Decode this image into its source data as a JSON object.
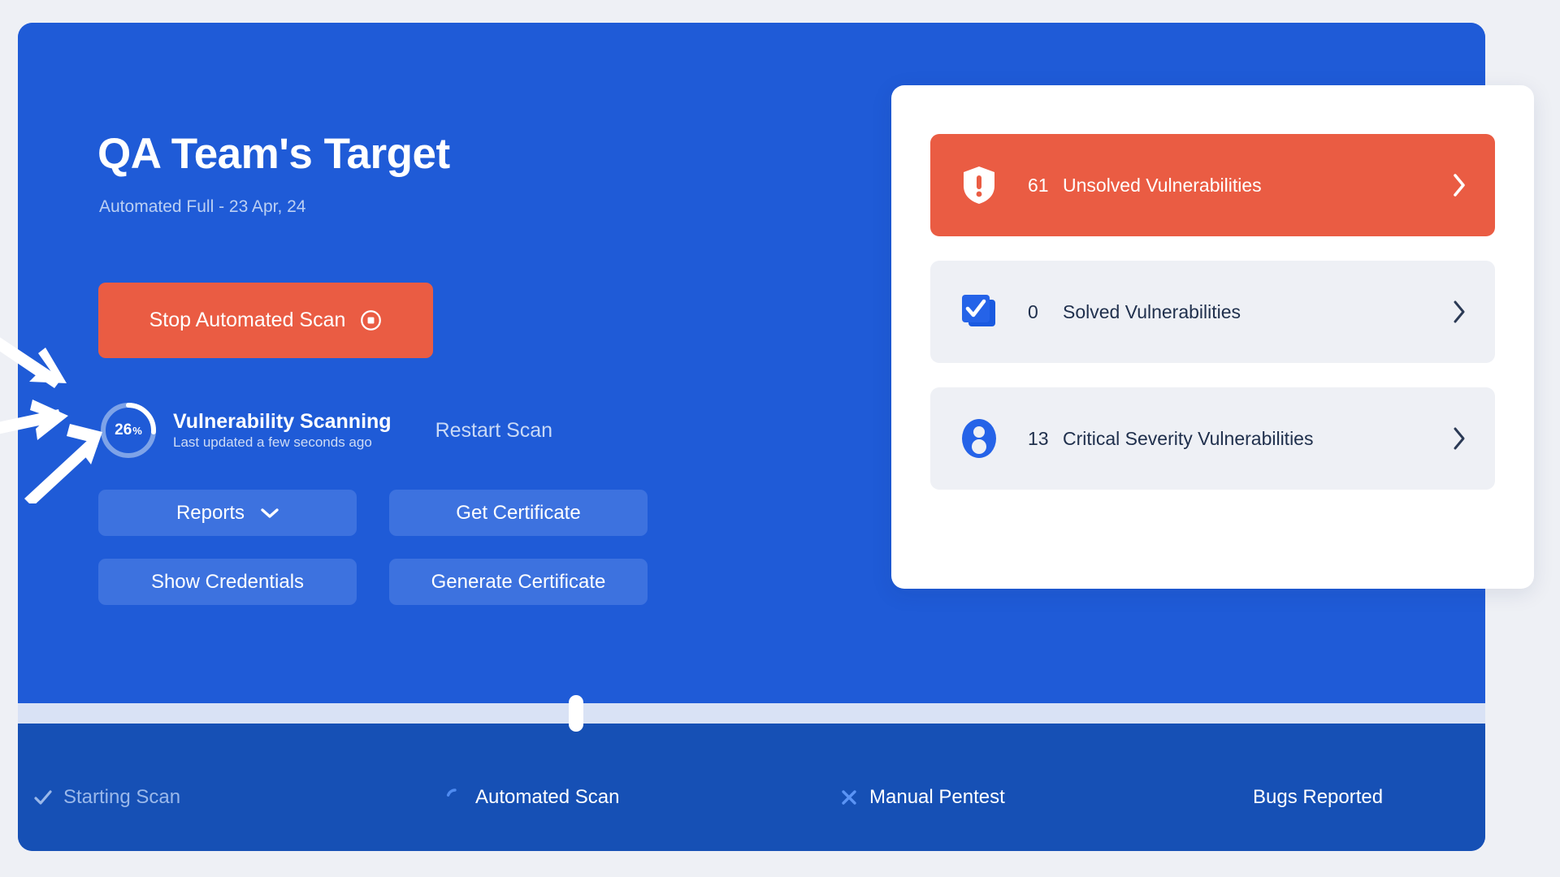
{
  "theme": {
    "page_bg": "#eef0f5",
    "panel_blue": "#1f5bd7",
    "footer_blue": "#1650b5",
    "accent_red": "#ea5c43",
    "button_blue": "#3d72df",
    "card_bg": "#eef0f5",
    "track": "#d9e2f5"
  },
  "header": {
    "title": "QA Team's Target",
    "subtitle": "Automated Full - 23 Apr, 24"
  },
  "scan": {
    "stop_button_label": "Stop Automated Scan",
    "stop_icon": "stop-circle-icon",
    "progress_percent": "26",
    "progress_percent_symbol": "%",
    "status_title": "Vulnerability Scanning",
    "status_subtitle": "Last updated a few seconds ago",
    "restart_label": "Restart Scan"
  },
  "actions": [
    {
      "label": "Reports",
      "icon": "chevron-down-icon",
      "has_chevron": true
    },
    {
      "label": "Get Certificate",
      "has_chevron": false
    },
    {
      "label": "Show Credentials",
      "has_chevron": false
    },
    {
      "label": "Generate Certificate",
      "has_chevron": false
    }
  ],
  "vulnerability_cards": [
    {
      "count": "61",
      "label": "Unsolved Vulnerabilities",
      "icon": "shield-alert-icon",
      "style": "danger",
      "chevron": "chevron-right-icon"
    },
    {
      "count": "0",
      "label": "Solved Vulnerabilities",
      "icon": "checkbox-stack-icon",
      "style": "default",
      "chevron": "chevron-right-icon"
    },
    {
      "count": "13",
      "label": "Critical Severity Vulnerabilities",
      "icon": "user-circle-icon",
      "style": "default",
      "chevron": "chevron-right-icon"
    }
  ],
  "progress_bar": {
    "fill_percent": "37",
    "handle_name": "progress-handle"
  },
  "steps": [
    {
      "label": "Starting Scan",
      "icon": "check-icon",
      "state": "done"
    },
    {
      "label": "Automated Scan",
      "icon": "spinner-icon",
      "state": "active"
    },
    {
      "label": "Manual Pentest",
      "icon": "x-icon",
      "state": "pending"
    },
    {
      "label": "Bugs Reported",
      "icon": "none",
      "state": "future"
    }
  ],
  "annotations": {
    "arrow_count": "3",
    "points_to": "progress-ring"
  }
}
